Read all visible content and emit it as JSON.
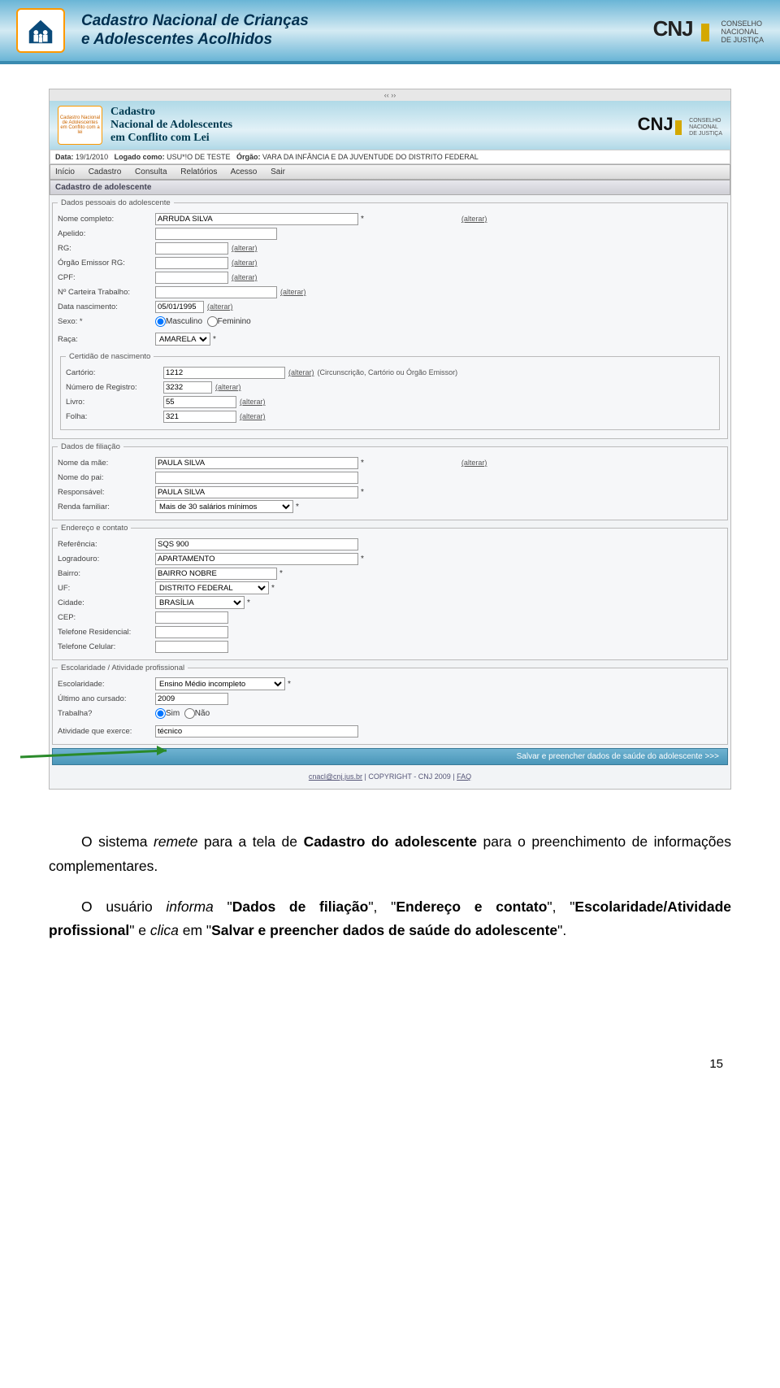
{
  "top_banner": {
    "title_line1": "Cadastro Nacional de Crianças",
    "title_line2": "e Adolescentes Acolhidos",
    "cnj": "CNJ",
    "cnj_sub1": "CONSELHO",
    "cnj_sub2": "NACIONAL",
    "cnj_sub3": "DE JUSTIÇA"
  },
  "app": {
    "nav_arrows": "‹‹ ››",
    "header_logo_text": "Cadastro Nacional de Adolescentes em Conflito com a lei",
    "header_line1": "Cadastro",
    "header_line2": "Nacional de Adolescentes",
    "header_line3": "em Conflito com Lei",
    "cnj": "CNJ",
    "cnj_sub1": "CONSELHO",
    "cnj_sub2": "NACIONAL",
    "cnj_sub3": "DE JUSTIÇA",
    "status": {
      "data_label": "Data:",
      "data_value": "19/1/2010",
      "logado_label": "Logado como:",
      "logado_value": "USU*!O DE TESTE",
      "orgao_label": "Órgão:",
      "orgao_value": "VARA DA INFÂNCIA E DA JUVENTUDE DO DISTRITO FEDERAL"
    },
    "menu": [
      "Início",
      "Cadastro",
      "Consulta",
      "Relatórios",
      "Acesso",
      "Sair"
    ],
    "section_title": "Cadastro de adolescente",
    "alterar": "(alterar)",
    "groups": {
      "pessoais": {
        "legend": "Dados pessoais do adolescente",
        "nome_completo_label": "Nome completo:",
        "nome_completo": "ARRUDA SILVA",
        "apelido_label": "Apelido:",
        "apelido": "",
        "rg_label": "RG:",
        "rg": "",
        "orgao_rg_label": "Órgão Emissor RG:",
        "orgao_rg": "",
        "cpf_label": "CPF:",
        "cpf": "",
        "carteira_label": "Nº Carteira Trabalho:",
        "carteira": "",
        "data_nasc_label": "Data nascimento:",
        "data_nasc": "05/01/1995",
        "sexo_label": "Sexo: *",
        "sexo_masc": "Masculino",
        "sexo_fem": "Feminino",
        "raca_label": "Raça:",
        "raca": "AMARELA",
        "certidao_legend": "Certidão de nascimento",
        "cartorio_label": "Cartório:",
        "cartorio": "1212",
        "cartorio_note": "(Circunscrição, Cartório ou Órgão Emissor)",
        "num_reg_label": "Número de Registro:",
        "num_reg": "3232",
        "livro_label": "Livro:",
        "livro": "55",
        "folha_label": "Folha:",
        "folha": "321"
      },
      "filiacao": {
        "legend": "Dados de filiação",
        "mae_label": "Nome da mãe:",
        "mae": "PAULA SILVA",
        "pai_label": "Nome do pai:",
        "pai": "",
        "resp_label": "Responsável:",
        "resp": "PAULA SILVA",
        "renda_label": "Renda familiar:",
        "renda": "Mais de 30 salários mínimos"
      },
      "endereco": {
        "legend": "Endereço e contato",
        "ref_label": "Referência:",
        "ref": "SQS 900",
        "logra_label": "Logradouro:",
        "logra": "APARTAMENTO",
        "bairro_label": "Bairro:",
        "bairro": "BAIRRO NOBRE",
        "uf_label": "UF:",
        "uf": "DISTRITO FEDERAL",
        "cidade_label": "Cidade:",
        "cidade": "BRASÍLIA",
        "cep_label": "CEP:",
        "cep": "",
        "tel_res_label": "Telefone Residencial:",
        "tel_res": "",
        "tel_cel_label": "Telefone Celular:",
        "tel_cel": ""
      },
      "escolaridade": {
        "legend": "Escolaridade / Atividade profissional",
        "escol_label": "Escolaridade:",
        "escol": "Ensino Médio incompleto",
        "ano_label": "Último ano cursado:",
        "ano": "2009",
        "trabalha_label": "Trabalha?",
        "sim": "Sim",
        "nao": "Não",
        "atividade_label": "Atividade que exerce:",
        "atividade": "técnico"
      }
    },
    "save_button": "Salvar e preencher dados de saúde do adolescente >>>",
    "footer_email": "cnacl@cnj.jus.br",
    "footer_copy": " | COPYRIGHT - CNJ 2009 | ",
    "footer_faq": "FAQ"
  },
  "doc": {
    "p1_a": "O sistema ",
    "p1_b": "remete",
    "p1_c": " para a tela de ",
    "p1_d": "Cadastro do adolescente",
    "p1_e": " para o preenchimento de informações complementares.",
    "p2_a": "O usuário ",
    "p2_b": "informa",
    "p2_c": " \"",
    "p2_d": "Dados de filiação",
    "p2_e": "\", \"",
    "p2_f": "Endereço e contato",
    "p2_g": "\", \"",
    "p2_h": "Escolaridade/Atividade profissional",
    "p2_i": "\" e ",
    "p2_j": "clica",
    "p2_k": " em \"",
    "p2_l": "Salvar e preencher dados de saúde do adolescente",
    "p2_m": "\"."
  },
  "page_number": "15"
}
